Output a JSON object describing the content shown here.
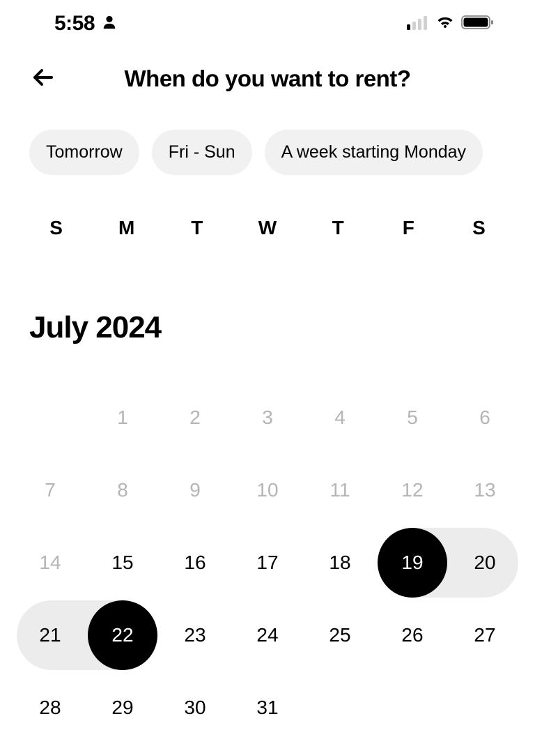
{
  "status": {
    "time": "5:58"
  },
  "header": {
    "title": "When do you want to rent?"
  },
  "chips": [
    "Tomorrow",
    "Fri - Sun",
    "A week starting Monday"
  ],
  "weekdays": [
    "S",
    "M",
    "T",
    "W",
    "T",
    "F",
    "S"
  ],
  "month": "July 2024",
  "calendar": {
    "weeks": [
      {
        "days": [
          {
            "n": "",
            "state": "empty"
          },
          {
            "n": "1",
            "state": "disabled"
          },
          {
            "n": "2",
            "state": "disabled"
          },
          {
            "n": "3",
            "state": "disabled"
          },
          {
            "n": "4",
            "state": "disabled"
          },
          {
            "n": "5",
            "state": "disabled"
          },
          {
            "n": "6",
            "state": "disabled"
          }
        ]
      },
      {
        "days": [
          {
            "n": "7",
            "state": "disabled"
          },
          {
            "n": "8",
            "state": "disabled"
          },
          {
            "n": "9",
            "state": "disabled"
          },
          {
            "n": "10",
            "state": "disabled"
          },
          {
            "n": "11",
            "state": "disabled"
          },
          {
            "n": "12",
            "state": "disabled"
          },
          {
            "n": "13",
            "state": "disabled"
          }
        ]
      },
      {
        "days": [
          {
            "n": "14",
            "state": "disabled"
          },
          {
            "n": "15",
            "state": "normal"
          },
          {
            "n": "16",
            "state": "normal"
          },
          {
            "n": "17",
            "state": "normal"
          },
          {
            "n": "18",
            "state": "normal"
          },
          {
            "n": "19",
            "state": "selected-start"
          },
          {
            "n": "20",
            "state": "in-range"
          }
        ],
        "range": {
          "startCol": 5,
          "endCol": 7
        }
      },
      {
        "days": [
          {
            "n": "21",
            "state": "in-range"
          },
          {
            "n": "22",
            "state": "selected-end"
          },
          {
            "n": "23",
            "state": "normal"
          },
          {
            "n": "24",
            "state": "normal"
          },
          {
            "n": "25",
            "state": "normal"
          },
          {
            "n": "26",
            "state": "normal"
          },
          {
            "n": "27",
            "state": "normal"
          }
        ],
        "range": {
          "startCol": 0,
          "endCol": 2
        }
      },
      {
        "days": [
          {
            "n": "28",
            "state": "normal"
          },
          {
            "n": "29",
            "state": "normal"
          },
          {
            "n": "30",
            "state": "normal"
          },
          {
            "n": "31",
            "state": "normal"
          },
          {
            "n": "",
            "state": "empty"
          },
          {
            "n": "",
            "state": "empty"
          },
          {
            "n": "",
            "state": "empty"
          }
        ]
      }
    ]
  }
}
